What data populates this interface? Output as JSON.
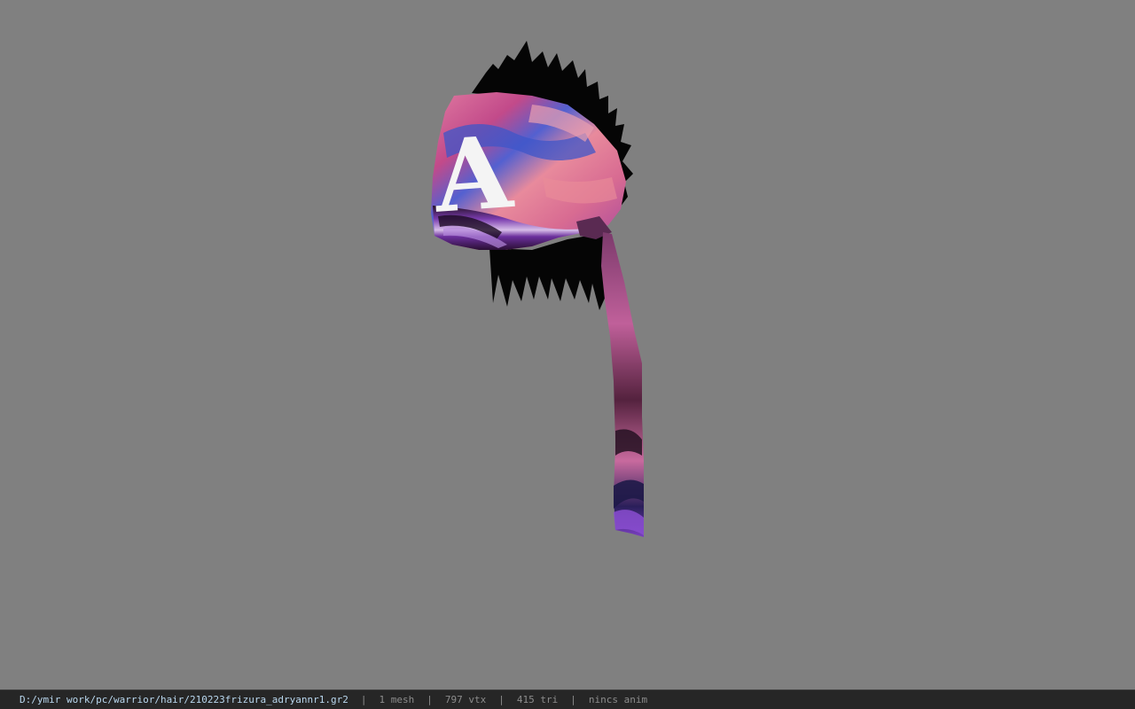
{
  "window": {
    "background_color": "#808080"
  },
  "viewport": {
    "model_name": "hair-bandana-model",
    "bandana_letter": "A",
    "colors": {
      "spikes": "#050505",
      "fabric_base": "#d9728f",
      "fabric_purple": "#7b3fb0",
      "fabric_blue": "#4a6fd8",
      "letter": "#f4f4f4"
    }
  },
  "status_bar": {
    "file_path": "D:/ymir work/pc/warrior/hair/210223frizura_adryannr1.gr2",
    "separator": "|",
    "mesh_count": "1 mesh",
    "vertex_count": "797 vtx",
    "triangle_count": "415 tri",
    "animation": "nincs anim"
  }
}
